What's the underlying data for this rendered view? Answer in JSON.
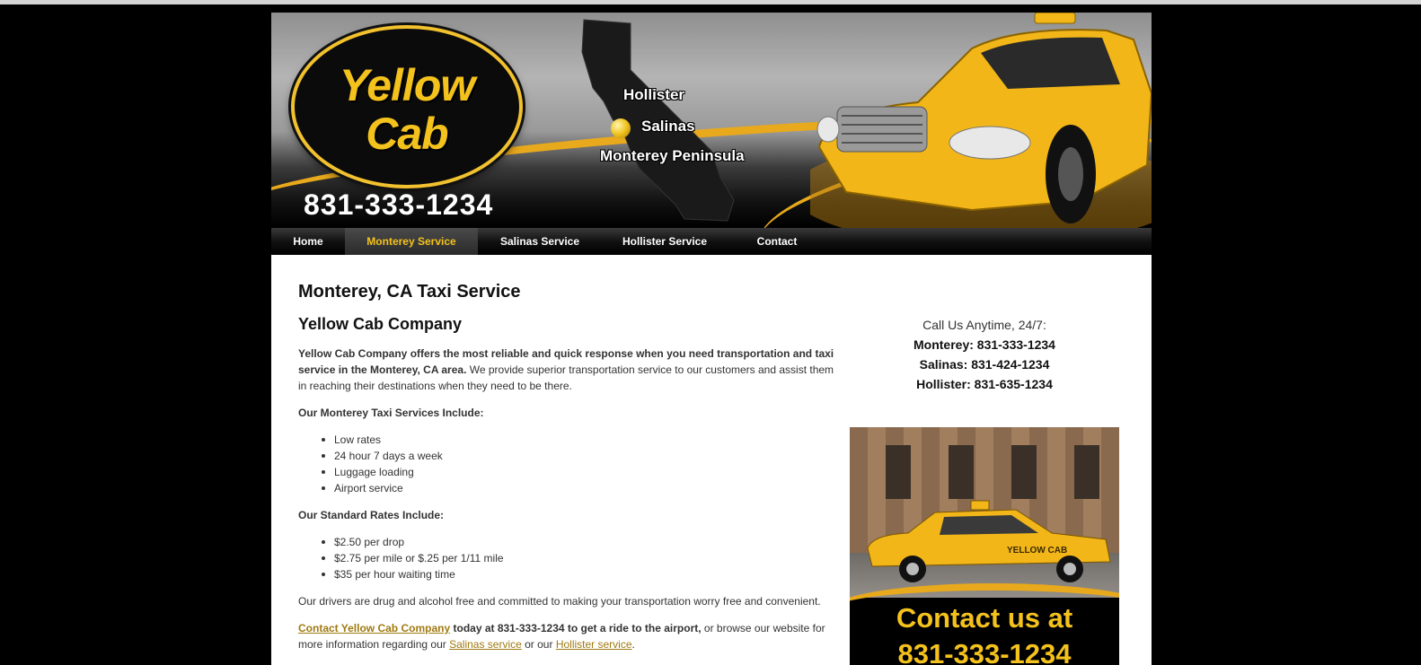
{
  "header": {
    "logo_line1": "Yellow",
    "logo_line2": "Cab",
    "phone": "831-333-1234",
    "cities": [
      "Hollister",
      "Salinas",
      "Monterey Peninsula"
    ]
  },
  "nav": {
    "items": [
      {
        "label": "Home"
      },
      {
        "label": "Monterey Service"
      },
      {
        "label": "Salinas Service"
      },
      {
        "label": "Hollister Service"
      },
      {
        "label": "Contact"
      }
    ],
    "active_index": 1
  },
  "main": {
    "title": "Monterey, CA Taxi Service",
    "subtitle": "Yellow Cab Company",
    "intro_bold": "Yellow Cab Company offers the most reliable and quick response when you need transportation and taxi service in the Monterey, CA area.",
    "intro_rest": " We provide superior transportation service to our customers and assist them in reaching their destinations when they need to be there.",
    "services_heading": "Our Monterey Taxi Services Include:",
    "services": [
      "Low rates",
      "24 hour 7 days a week",
      "Luggage loading",
      "Airport service"
    ],
    "rates_heading": "Our Standard Rates Include:",
    "rates": [
      "$2.50 per drop",
      "$2.75 per mile or $.25 per 1/11 mile",
      "$35 per hour waiting time"
    ],
    "drivers_text": "Our drivers are drug and alcohol free and committed to making your transportation worry free and convenient.",
    "contact_link": "Contact Yellow Cab Company",
    "contact_bold": " today at 831-333-1234 to get a ride to the airport,",
    "contact_rest1": " or browse our website for more information regarding our ",
    "salinas_link": "Salinas service",
    "contact_mid": " or our ",
    "hollister_link": "Hollister service",
    "contact_end": "."
  },
  "sidebar": {
    "call_heading": "Call Us Anytime, 24/7:",
    "phones": [
      "Monterey: 831-333-1234",
      "Salinas: 831-424-1234",
      "Hollister: 831-635-1234"
    ],
    "promo_line1": "Contact us at",
    "promo_line2": "831-333-1234",
    "promo_car_text": "YELLOW CAB"
  },
  "colors": {
    "accent": "#f4c21c",
    "link": "#a07a10",
    "background": "#000000"
  }
}
